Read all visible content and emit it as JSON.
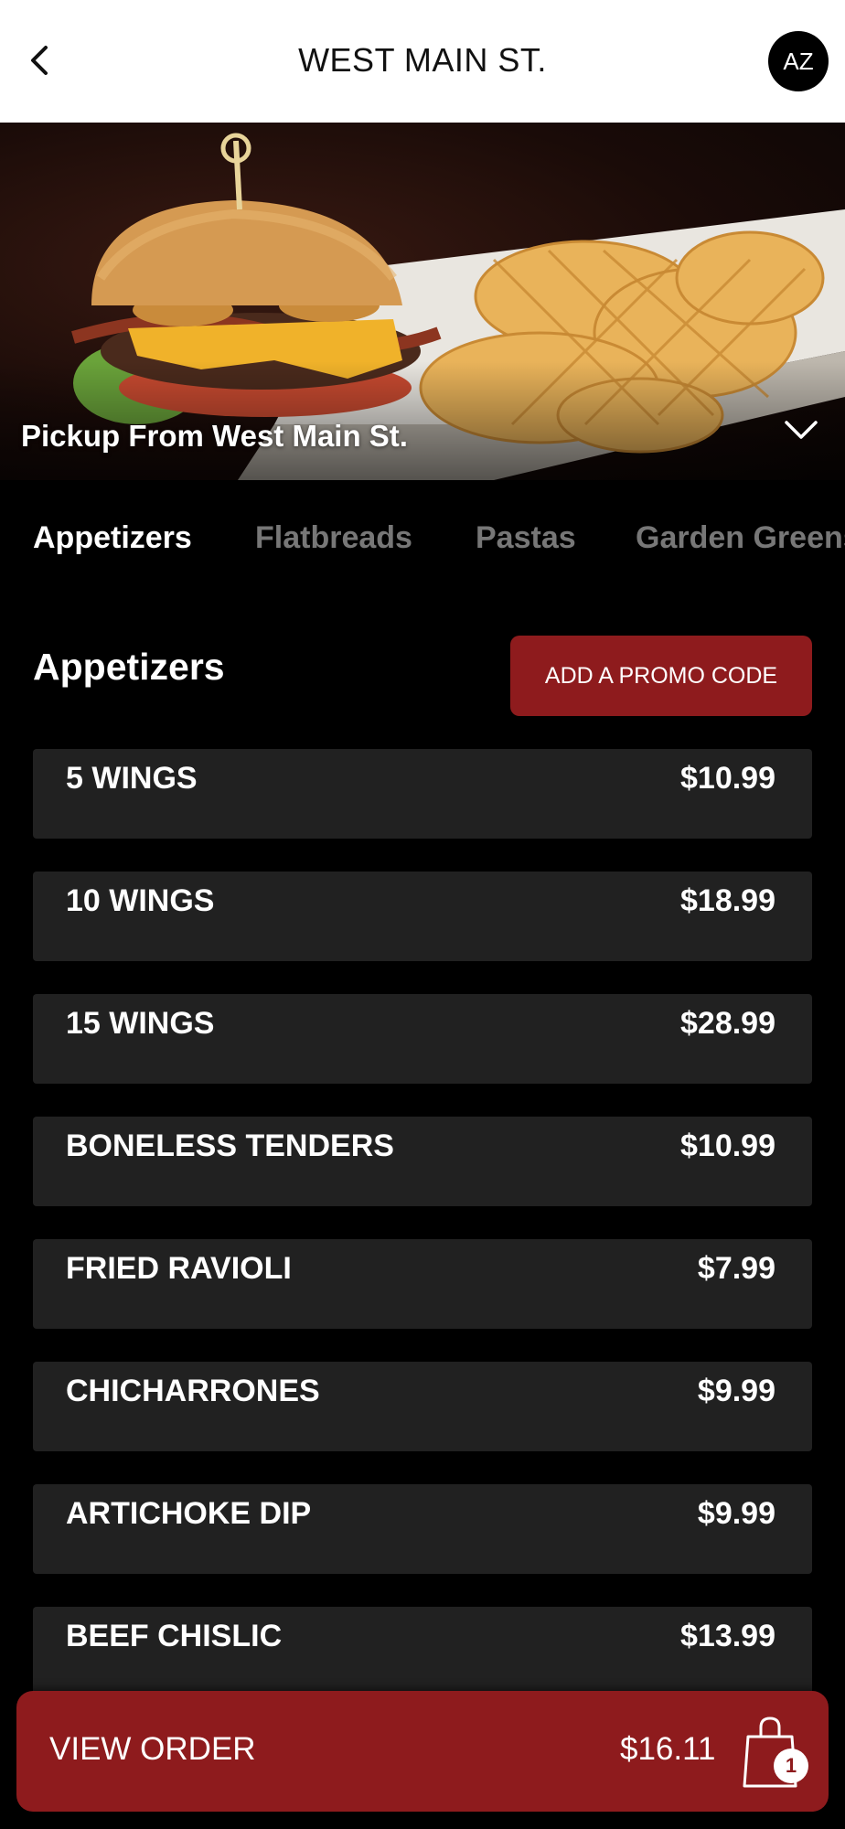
{
  "header": {
    "title": "WEST MAIN ST.",
    "avatar_initials": "AZ"
  },
  "hero": {
    "pickup_text": "Pickup From West Main St."
  },
  "tabs": [
    {
      "label": "Appetizers",
      "active": true
    },
    {
      "label": "Flatbreads",
      "active": false
    },
    {
      "label": "Pastas",
      "active": false
    },
    {
      "label": "Garden Greens",
      "active": false
    }
  ],
  "section": {
    "title": "Appetizers",
    "promo_label": "ADD A PROMO CODE"
  },
  "items": [
    {
      "name": "5 WINGS",
      "price": "$10.99"
    },
    {
      "name": "10 WINGS",
      "price": "$18.99"
    },
    {
      "name": "15 WINGS",
      "price": "$28.99"
    },
    {
      "name": "BONELESS TENDERS",
      "price": "$10.99"
    },
    {
      "name": "FRIED RAVIOLI",
      "price": "$7.99"
    },
    {
      "name": "CHICHARRONES",
      "price": "$9.99"
    },
    {
      "name": "ARTICHOKE DIP",
      "price": "$9.99"
    },
    {
      "name": "BEEF CHISLIC",
      "price": "$13.99"
    }
  ],
  "order_bar": {
    "label": "VIEW ORDER",
    "total": "$16.11",
    "count": "1"
  },
  "colors": {
    "accent": "#8e1b1d",
    "background": "#000000",
    "card": "#212121"
  }
}
